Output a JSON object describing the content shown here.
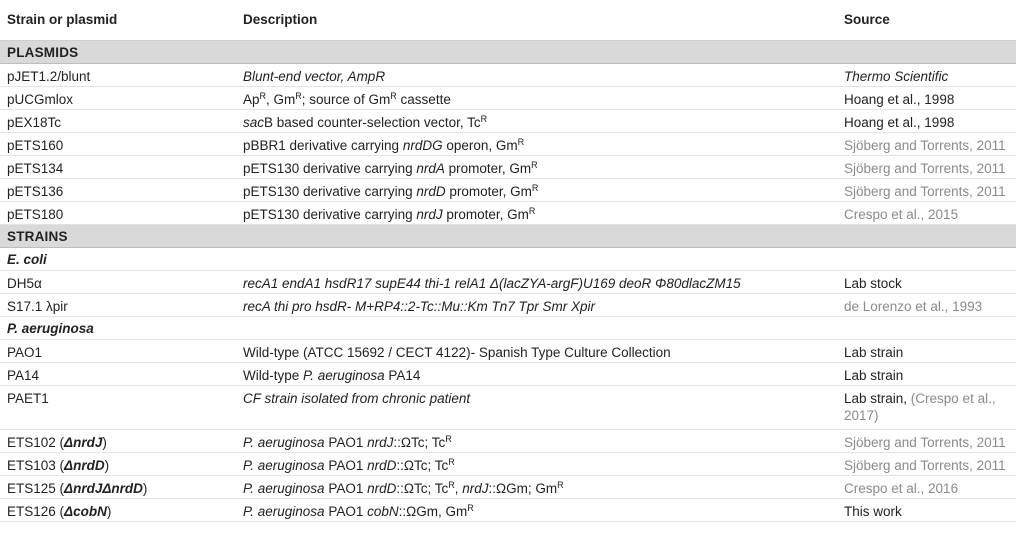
{
  "header": {
    "col1": "Strain or plasmid",
    "col2": "Description",
    "col3": "Source"
  },
  "sections": {
    "plasmids": "PLASMIDS",
    "strains": "STRAINS",
    "ecoli": "E. coli",
    "paeruginosa": "P. aeruginosa"
  },
  "rows": {
    "pjet": {
      "name": "pJET1.2/blunt",
      "desc": "Blunt-end vector, AmpR",
      "source": "Thermo Scientific"
    },
    "pucg": {
      "name": "pUCGmlox",
      "d1": "Ap",
      "d2": "R",
      "d3": ", Gm",
      "d4": "R",
      "d5": "; source of Gm",
      "d6": "R",
      "d7": " cassette",
      "source": "Hoang et al., 1998"
    },
    "pex": {
      "name": "pEX18Tc",
      "d1": "sac",
      "d2": "B based counter-selection vector, Tc",
      "d3": "R",
      "source": "Hoang et al., 1998"
    },
    "p160": {
      "name": "pETS160",
      "d1": "pBBR1 derivative carrying ",
      "d2": "nrdDG",
      "d3": " operon, Gm",
      "d4": "R",
      "source": "Sjöberg and Torrents, 2011"
    },
    "p134": {
      "name": "pETS134",
      "d1": "pETS130 derivative carrying ",
      "d2": "nrdA",
      "d3": " promoter, Gm",
      "d4": "R",
      "source": "Sjöberg and Torrents, 2011"
    },
    "p136": {
      "name": "pETS136",
      "d1": "pETS130 derivative carrying ",
      "d2": "nrdD",
      "d3": " promoter, Gm",
      "d4": "R",
      "source": "Sjöberg and Torrents, 2011"
    },
    "p180": {
      "name": "pETS180",
      "d1": "pETS130 derivative carrying ",
      "d2": "nrdJ",
      "d3": " promoter, Gm",
      "d4": "R",
      "source": "Crespo et al., 2015"
    },
    "dh5": {
      "name": "DH5α",
      "desc": "recA1 endA1 hsdR17 supE44 thi-1 relA1 Δ(lacZYA-argF)U169 deoR Φ80dlacZM15",
      "source": "Lab stock"
    },
    "s17": {
      "name": "S17.1 λpir",
      "desc": "recA thi pro hsdR- M+RP4::2-Tc::Mu::Km Tn7 Tpr Smr Xpir",
      "source": "de Lorenzo et al., 1993"
    },
    "pao1": {
      "name": "PAO1",
      "desc": "Wild-type (ATCC 15692 / CECT 4122)- Spanish Type Culture Collection",
      "source": "Lab strain"
    },
    "pa14": {
      "name": "PA14",
      "d1": "Wild-type ",
      "d2": "P. aeruginosa",
      "d3": " PA14",
      "source": "Lab strain"
    },
    "paet1": {
      "name": "PAET1",
      "desc": "CF strain isolated from chronic patient",
      "s1": "Lab strain, ",
      "s2": "(Crespo et al., 2017)"
    },
    "e102": {
      "n1": "ETS102 (",
      "n2": "ΔnrdJ",
      "n3": ")",
      "d1": "P. aeruginosa",
      "d2": " PAO1 ",
      "d3": "nrdJ",
      "d4": "::ΩTc; Tc",
      "d5": "R",
      "source": "Sjöberg and Torrents, 2011"
    },
    "e103": {
      "n1": "ETS103 (",
      "n2": "ΔnrdD",
      "n3": ")",
      "d1": "P. aeruginosa",
      "d2": " PAO1 ",
      "d3": "nrdD",
      "d4": "::ΩTc; Tc",
      "d5": "R",
      "source": "Sjöberg and Torrents, 2011"
    },
    "e125": {
      "n1": "ETS125 (",
      "n2": "ΔnrdJΔnrdD",
      "n3": ")",
      "d1": "P. aeruginosa",
      "d2": " PAO1 ",
      "d3": "nrdD",
      "d4": "::ΩTc; Tc",
      "d5": "R",
      "d6": ", ",
      "d7": "nrdJ",
      "d8": "::ΩGm; Gm",
      "d9": "R",
      "source": "Crespo et al., 2016"
    },
    "e126": {
      "n1": "ETS126 (",
      "n2": "ΔcobN",
      "n3": ")",
      "d1": "P. aeruginosa",
      "d2": " PAO1 ",
      "d3": "cobN",
      "d4": "::ΩGm, Gm",
      "d5": "R",
      "source": "This work"
    }
  }
}
